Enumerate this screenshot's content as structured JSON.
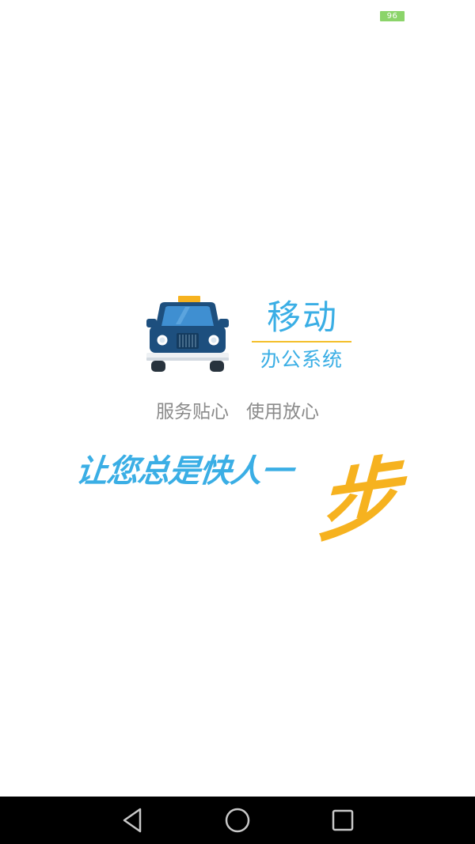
{
  "status_bar": {
    "battery_level": "96",
    "battery_color": "#8bd46a"
  },
  "splash": {
    "logo_icon": "taxi-car-icon",
    "brand": {
      "title": "移动",
      "subtitle": "办公系统"
    },
    "tagline": "服务贴心   使用放心",
    "slogan": {
      "main": "让您总是快人一",
      "accent": "步"
    },
    "colors": {
      "brand_blue": "#3aaee5",
      "accent_yellow": "#f6b21f",
      "car_body": "#1d4f7e",
      "tagline_gray": "#8a8a8a"
    }
  },
  "nav_bar": {
    "back_icon": "back-triangle-icon",
    "home_icon": "home-circle-icon",
    "recents_icon": "recents-square-icon"
  }
}
